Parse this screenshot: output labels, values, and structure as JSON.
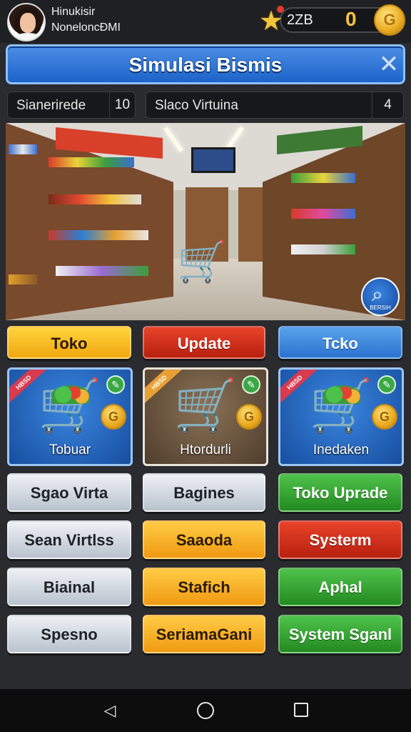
{
  "header": {
    "user_name": "Hinukisir",
    "user_subtitle": "NoneloncĐMI",
    "stat_left": "2ZB",
    "stat_right": "0"
  },
  "title": "Simulasi Bismis",
  "info": [
    {
      "label": "Sianerirede",
      "value": "10"
    },
    {
      "label": "Slaco Virtuina",
      "value": "4"
    }
  ],
  "scene": {
    "search_caption": "BERSIH"
  },
  "top_buttons": [
    "Toko",
    "Update",
    "Tcko"
  ],
  "cards": [
    {
      "ribbon": "HBSD",
      "label": "Tobuar"
    },
    {
      "ribbon": "HBSD",
      "label": "Htordurli"
    },
    {
      "ribbon": "HBSD",
      "label": "Inedaken"
    }
  ],
  "grid_buttons": [
    [
      "Sgao Virta",
      "Bagines",
      "Toko Uprade"
    ],
    [
      "Sean Virtlss",
      "Saaoda",
      "Systerm"
    ],
    [
      "Biainal",
      "Stafich",
      "Aphal"
    ],
    [
      "Spesno",
      "SeriamaGani",
      "System Sganl"
    ]
  ],
  "colors": {
    "title_banner": "#2b72cf",
    "accent_gold": "#f7c23a"
  }
}
